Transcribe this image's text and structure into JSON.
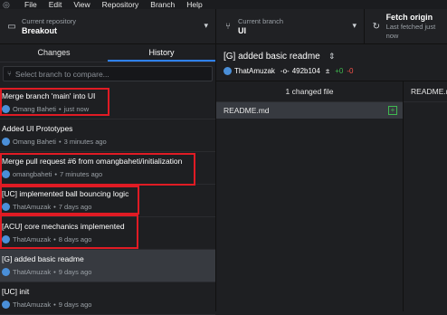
{
  "menubar": {
    "items": [
      "File",
      "Edit",
      "View",
      "Repository",
      "Branch",
      "Help"
    ]
  },
  "toolbar": {
    "repo": {
      "sublabel": "Current repository",
      "name": "Breakout"
    },
    "branch": {
      "sublabel": "Current branch",
      "name": "UI"
    },
    "fetch": {
      "label": "Fetch origin",
      "sublabel": "Last fetched just now"
    }
  },
  "sidebar": {
    "tabs": [
      "Changes",
      "History"
    ],
    "active_tab": "History",
    "filter_placeholder": "Select branch to compare...",
    "commits": [
      {
        "title": "Merge branch 'main' into UI",
        "author": "Omang Baheti",
        "time": "just now"
      },
      {
        "title": "Added UI Prototypes",
        "author": "Omang Baheti",
        "time": "3 minutes ago"
      },
      {
        "title": "Merge pull request #6 from omangbaheti/initialization",
        "author": "omangbaheti",
        "time": "7 minutes ago"
      },
      {
        "title": "[UC] implemented ball bouncing logic",
        "author": "ThatAmuzak",
        "time": "7 days ago"
      },
      {
        "title": "[ACU] core mechanics implemented",
        "author": "ThatAmuzak",
        "time": "8 days ago"
      },
      {
        "title": "[G] added basic readme",
        "author": "ThatAmuzak",
        "time": "9 days ago"
      },
      {
        "title": "[UC] init",
        "author": "ThatAmuzak",
        "time": "9 days ago"
      }
    ]
  },
  "commit_detail": {
    "title": "[G] added basic readme",
    "author": "ThatAmuzak",
    "sha": "492b104",
    "additions": "+0",
    "deletions": "-0",
    "changed_files_label": "1 changed file",
    "files": [
      {
        "name": "README.md",
        "status": "added"
      }
    ],
    "diff_header": "README.md"
  },
  "colors": {
    "accent": "#2f81f7",
    "highlight_box": "#e01b24",
    "added": "#3fb950",
    "removed": "#f85149"
  }
}
